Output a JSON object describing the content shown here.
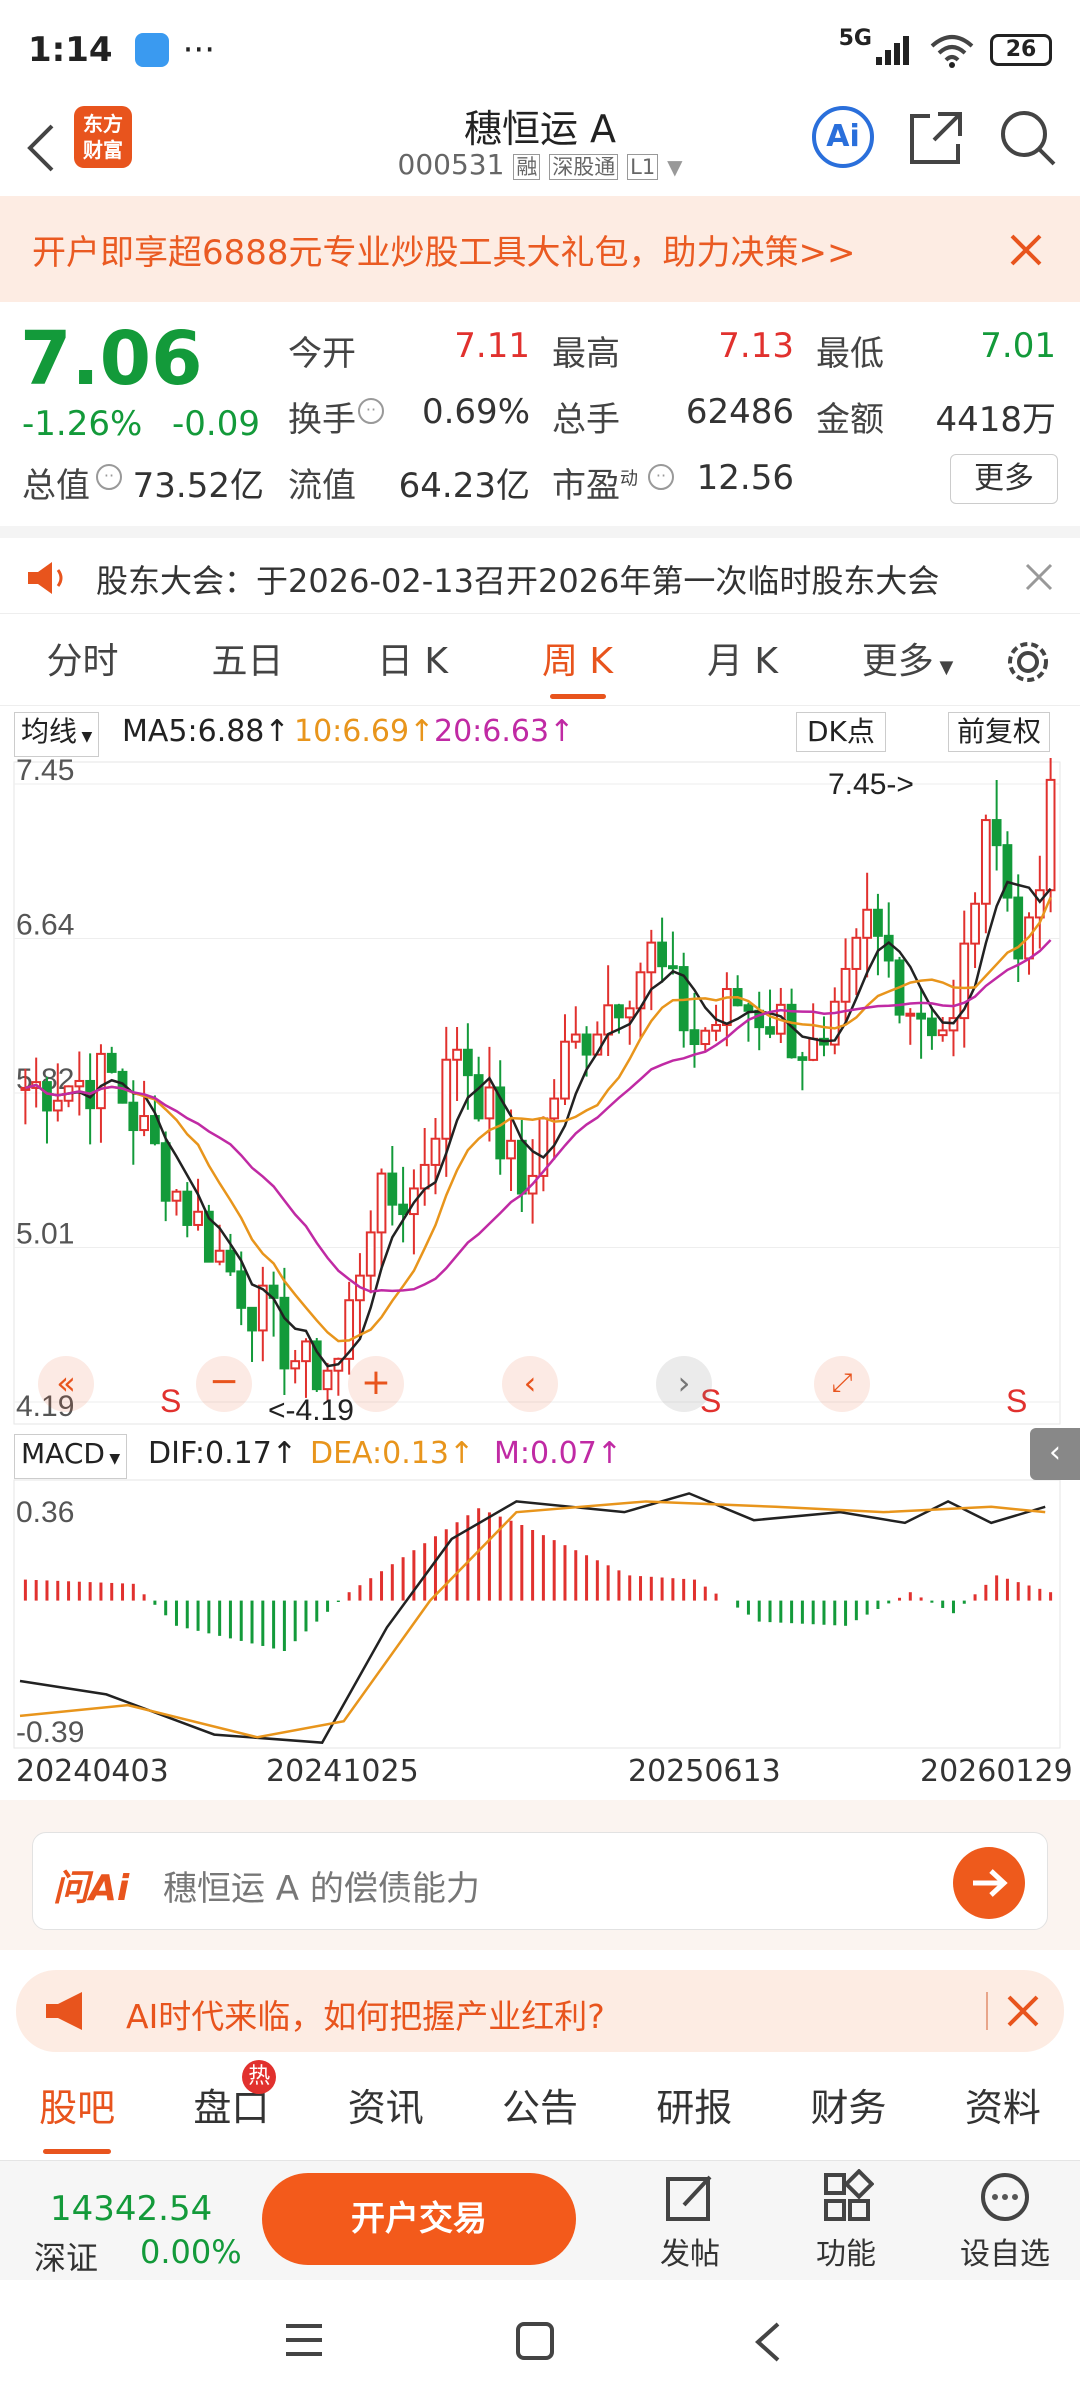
{
  "status": {
    "time": "1:14",
    "network": "5G",
    "battery": "26",
    "dots": "···"
  },
  "header": {
    "title": "穗恒运 A",
    "code": "000531",
    "tag_margin": "融",
    "tag_connect": "深股通",
    "tag_level": "L1",
    "logo_text1": "东方",
    "logo_text2": "财富",
    "ai_label": "Ai"
  },
  "banner": {
    "text": "开户即享超6888元专业炒股工具大礼包，助力决策>>"
  },
  "quote": {
    "price": "7.06",
    "change_pct": "-1.26%",
    "change": "-0.09",
    "open_label": "今开",
    "open": "7.11",
    "high_label": "最高",
    "high": "7.13",
    "low_label": "最低",
    "low": "7.01",
    "turnover_label": "换手",
    "turnover": "0.69%",
    "volume_label": "总手",
    "volume": "62486",
    "amount_label": "金额",
    "amount": "4418万",
    "mcap_label": "总值",
    "mcap": "73.52亿",
    "float_label": "流值",
    "float": "64.23亿",
    "pe_label": "市盈",
    "pe_sup": "动",
    "pe": "12.56",
    "more": "更多"
  },
  "notice": {
    "text": "股东大会：于2026-02-13召开2026年第一次临时股东大会"
  },
  "chart_tabs": [
    "分时",
    "五日",
    "日 K",
    "周 K",
    "月 K",
    "更多"
  ],
  "active_chart_tab": 3,
  "ma": {
    "selector": "均线",
    "ma5": "MA5:6.88",
    "ma10": "10:6.69",
    "ma20": "20:6.63",
    "dk": "DK点",
    "adjust": "前复权"
  },
  "chart_data": {
    "type": "candlestick",
    "y_ticks": [
      "7.45",
      "6.64",
      "5.82",
      "5.01",
      "4.19"
    ],
    "ylim": [
      4.19,
      7.45
    ],
    "max_label": "7.45->",
    "min_label": "<-4.19",
    "dates": [
      "20240403",
      "20241025",
      "20250613",
      "20260129"
    ],
    "sell_marks": [
      "S",
      "S",
      "S"
    ],
    "macd": {
      "selector": "MACD",
      "dif": "DIF:0.17",
      "dea": "DEA:0.13",
      "m": "M:0.07",
      "y_ticks": [
        "0.36",
        "-0.39"
      ]
    }
  },
  "ai_search": {
    "brand": "问Ai",
    "placeholder": "穗恒运 A 的偿债能力"
  },
  "promo": {
    "text": "AI时代来临，如何把握产业红利?"
  },
  "bottom_tabs": [
    "股吧",
    "盘口",
    "资讯",
    "公告",
    "研报",
    "财务",
    "资料"
  ],
  "hot_badge": "热",
  "index": {
    "value": "14342.54",
    "name": "深证",
    "change": "0.00%"
  },
  "trade_button": "开户交易",
  "actions": {
    "post": "发帖",
    "function": "功能",
    "watch": "设自选"
  },
  "colors": {
    "up": "#e1312e",
    "down": "#139a3a",
    "accent": "#e8541d",
    "ma10": "#e8951c",
    "ma20": "#c02aa4"
  }
}
